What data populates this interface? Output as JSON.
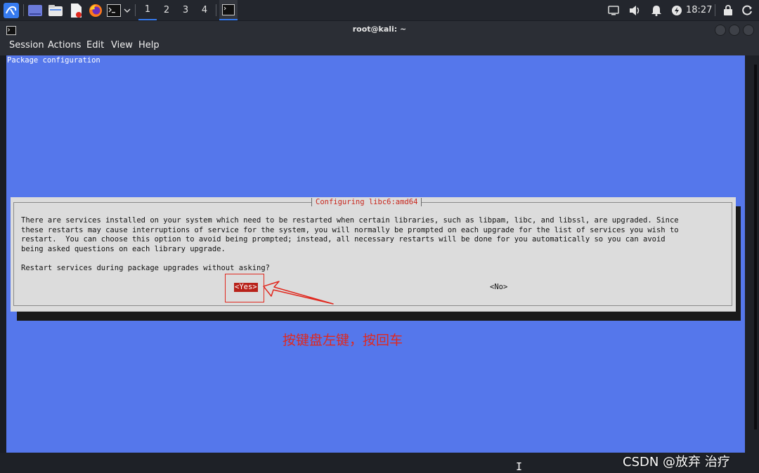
{
  "panel": {
    "workspaces": [
      "1",
      "2",
      "3",
      "4"
    ],
    "active_workspace": "1",
    "time": "18:27",
    "icons": [
      "kali-menu-icon",
      "desktop-icon",
      "file-manager-icon",
      "text-editor-icon",
      "firefox-icon",
      "terminal-icon",
      "chevron-down-icon",
      "terminal-task-icon",
      "display-icon",
      "volume-icon",
      "notification-bell-icon",
      "power-manager-icon",
      "lock-icon",
      "logout-icon"
    ]
  },
  "window": {
    "title": "root@kali: ~",
    "menu": [
      "Session",
      "Actions",
      "Edit",
      "View",
      "Help"
    ]
  },
  "terminal": {
    "header": "Package configuration",
    "background": "#5577eb",
    "dialog": {
      "title": "Configuring libc6:amd64",
      "lines": [
        "There are services installed on your system which need to be restarted when certain libraries, such as libpam, libc, and libssl, are upgraded. Since",
        "these restarts may cause interruptions of service for the system, you will normally be prompted on each upgrade for the list of services you wish to",
        "restart.  You can choose this option to avoid being prompted; instead, all necessary restarts will be done for you automatically so you can avoid",
        "being asked questions on each library upgrade.",
        "",
        "Restart services during package upgrades without asking?"
      ],
      "yes_label": "<Yes>",
      "no_label": "<No>",
      "selected_color": "#b8221a"
    }
  },
  "annotation": {
    "text": "按键盘左键，按回车",
    "color": "#e0281e"
  },
  "watermark": "CSDN @放弃    治疗"
}
